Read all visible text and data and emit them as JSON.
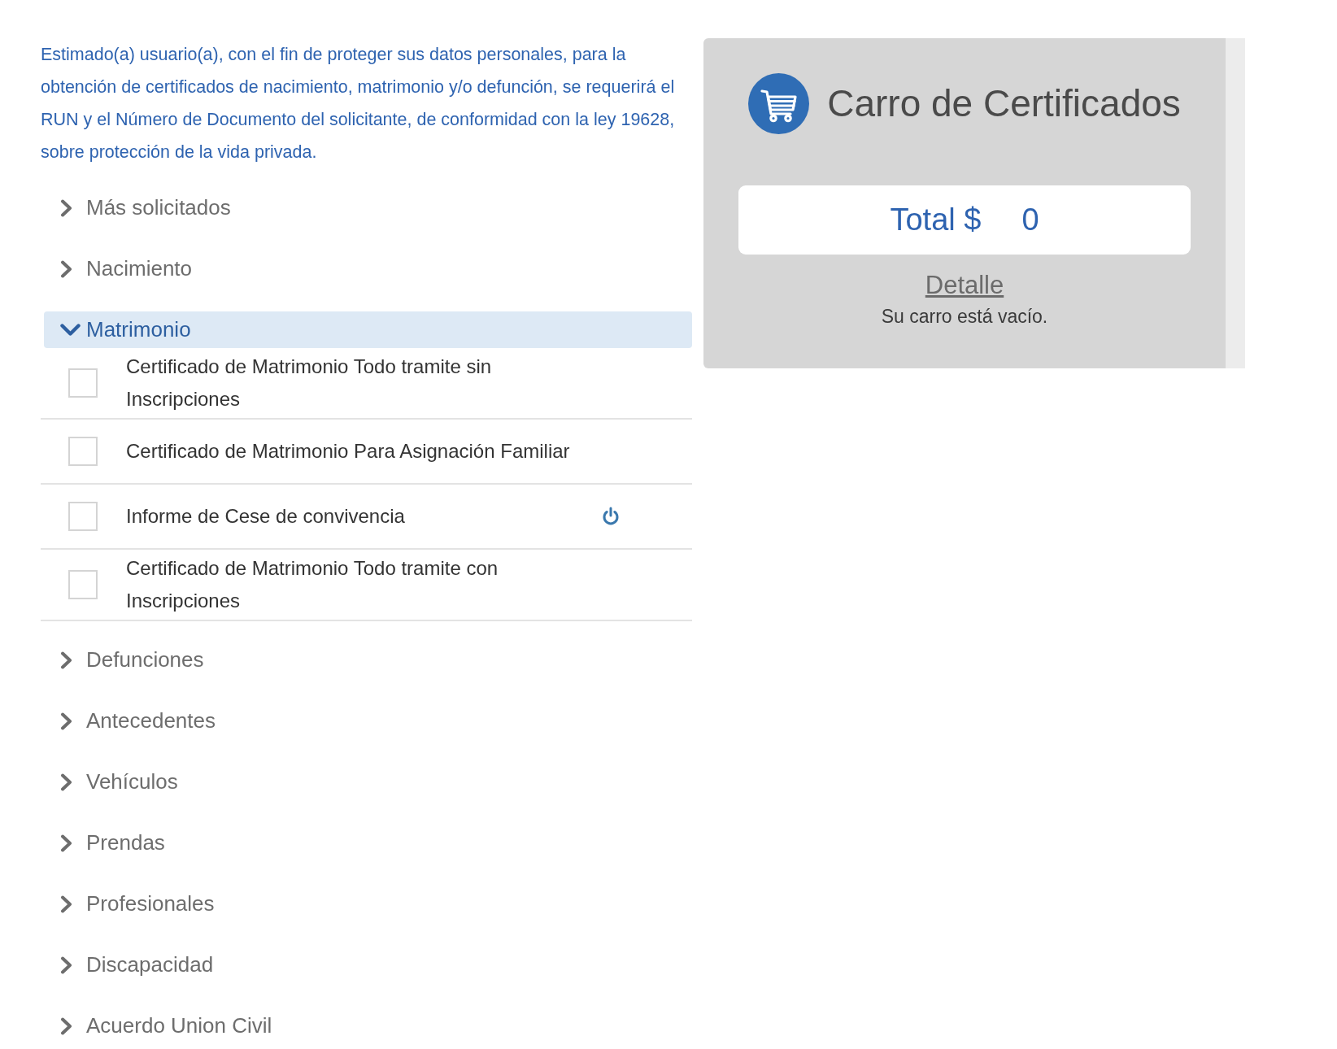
{
  "notice": "Estimado(a) usuario(a), con el fin de proteger sus datos personales, para la obtención de certificados de nacimiento, matrimonio y/o defunción, se requerirá el RUN y el Número de Documento del solicitante, de conformidad con la ley 19628, sobre protección de la vida privada.",
  "categories": [
    {
      "label": "Más solicitados",
      "expanded": false
    },
    {
      "label": "Nacimiento",
      "expanded": false
    },
    {
      "label": "Matrimonio",
      "expanded": true,
      "items": [
        {
          "label": "Certificado de Matrimonio Todo tramite sin Inscripciones",
          "checked": false,
          "kind": "plain"
        },
        {
          "label": "Certificado de Matrimonio Para Asignación Familiar",
          "checked": false,
          "kind": "plain"
        },
        {
          "label": "Informe de Cese de convivencia",
          "checked": false,
          "kind": "power"
        },
        {
          "label": "Certificado de Matrimonio Todo tramite con Inscripciones",
          "checked": false,
          "kind": "plain"
        }
      ]
    },
    {
      "label": "Defunciones",
      "expanded": false
    },
    {
      "label": "Antecedentes",
      "expanded": false
    },
    {
      "label": "Vehículos",
      "expanded": false
    },
    {
      "label": "Prendas",
      "expanded": false
    },
    {
      "label": "Profesionales",
      "expanded": false
    },
    {
      "label": "Discapacidad",
      "expanded": false
    },
    {
      "label": "Acuerdo Union Civil",
      "expanded": false
    }
  ],
  "cart": {
    "title": "Carro de Certificados",
    "total_label": "Total $",
    "total_value": "0",
    "detail_link": "Detalle",
    "empty_message": "Su carro está vacío."
  }
}
